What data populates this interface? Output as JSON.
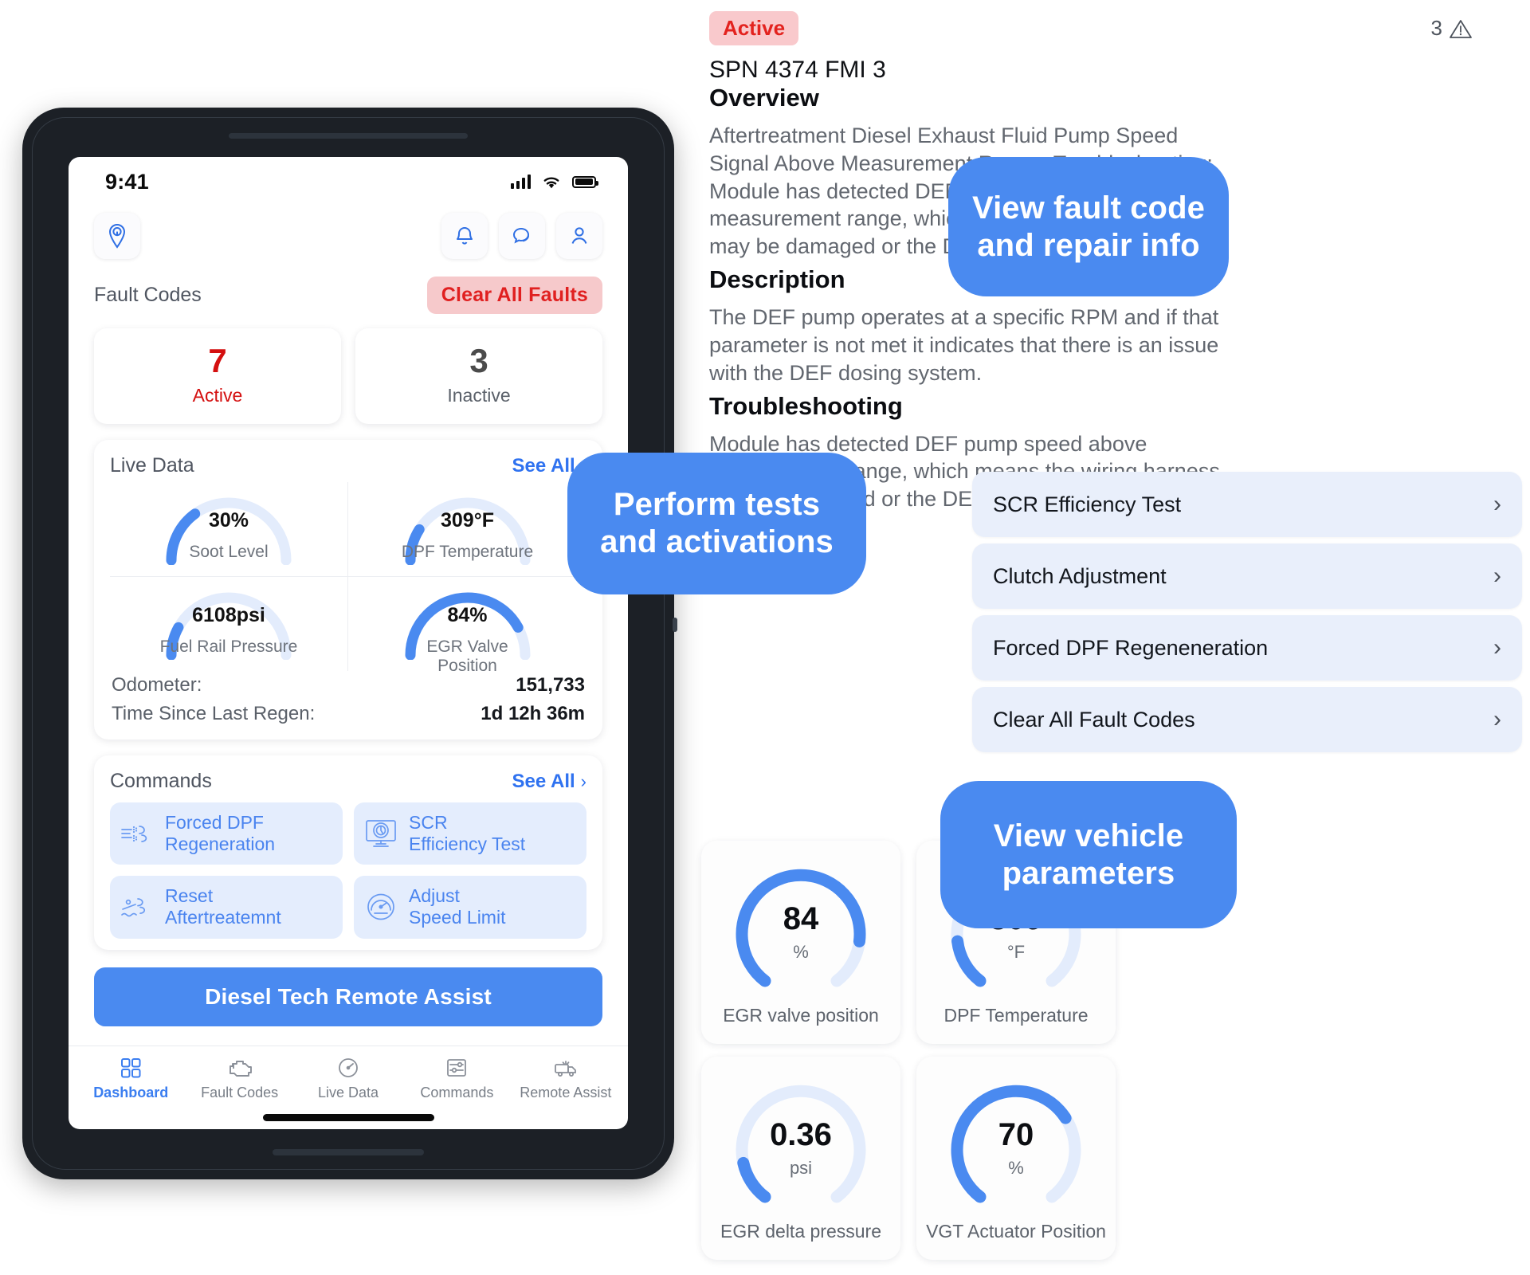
{
  "tablet": {
    "status_bar": {
      "time": "9:41"
    },
    "app_header": {
      "logo_icon": "wrench-location-pin-icon",
      "actions": [
        {
          "icon": "bell-icon",
          "name": "notifications"
        },
        {
          "icon": "chat-bubbles-icon",
          "name": "messages"
        },
        {
          "icon": "user-icon",
          "name": "profile"
        }
      ]
    },
    "fault_codes": {
      "title": "Fault Codes",
      "clear_button": "Clear All Faults",
      "cards": [
        {
          "count": "7",
          "label": "Active"
        },
        {
          "count": "3",
          "label": "Inactive"
        }
      ]
    },
    "live_data": {
      "title": "Live Data",
      "see_all": "See All",
      "chevron": "›",
      "gauges": [
        {
          "value": "30%",
          "label": "Soot Level",
          "pct": 30
        },
        {
          "value": "309°F",
          "label": "DPF Temperature",
          "pct": 18
        },
        {
          "value": "6108psi",
          "label": "Fuel Rail Pressure",
          "pct": 16
        },
        {
          "value": "84%",
          "label": "EGR Valve Position",
          "pct": 84
        }
      ],
      "rows": [
        {
          "key": "Odometer:",
          "value": "151,733"
        },
        {
          "key": "Time Since Last Regen:",
          "value": "1d 12h 36m"
        }
      ]
    },
    "commands": {
      "title": "Commands",
      "see_all": "See All",
      "chevron": "›",
      "items": [
        {
          "label": "Forced DPF\nRegeneration",
          "icon": "dpf-exhaust-icon"
        },
        {
          "label": "SCR\nEfficiency Test",
          "icon": "monitor-gauge-icon"
        },
        {
          "label": "Reset\nAftertreatemnt",
          "icon": "aftertreatment-icon"
        },
        {
          "label": "Adjust\nSpeed Limit",
          "icon": "speedometer-icon"
        }
      ]
    },
    "primary_button": "Diesel Tech Remote Assist",
    "tabbar": [
      {
        "label": "Dashboard",
        "icon": "grid-icon",
        "active": true
      },
      {
        "label": "Fault Codes",
        "icon": "engine-icon",
        "active": false
      },
      {
        "label": "Live Data",
        "icon": "gauge-icon",
        "active": false
      },
      {
        "label": "Commands",
        "icon": "sliders-icon",
        "active": false
      },
      {
        "label": "Remote Assist",
        "icon": "truck-icon",
        "active": false
      }
    ]
  },
  "detail": {
    "status_badge": "Active",
    "warning_count": "3",
    "warning_icon": "warning-triangle-icon",
    "code_title": "SPN 4374 FMI 3",
    "overview_heading": "Overview",
    "overview_body": "Aftertreatment Diesel Exhaust Fluid Pump Speed\nSignal Above Measurement Range. Troubleshooting:\nModule has detected DEF pump speed above\nmeasurement range, which means the wiring harness\nmay be damaged or the DEF pump has failed.",
    "description_heading": "Description",
    "description_body": "The DEF pump operates at a specific RPM and if that\nparameter is not met it indicates that there is an issue\nwith the DEF dosing system.",
    "troubleshooting_heading": "Troubleshooting",
    "troubleshooting_body": "Module has detected DEF pump speed above\nmeasurement range, which means the wiring harness\nmay be damaged or the DEF pump has failed."
  },
  "tests": {
    "chevron": "›",
    "items": [
      {
        "label": "SCR Efficiency Test"
      },
      {
        "label": "Clutch Adjustment"
      },
      {
        "label": "Forced DPF Regeneneration"
      },
      {
        "label": "Clear All Fault Codes"
      }
    ]
  },
  "parameter_gauges": [
    {
      "value": "84",
      "unit": "%",
      "label": "EGR valve position",
      "pct": 84
    },
    {
      "value": "309",
      "unit": "°F",
      "label": "DPF Temperature",
      "pct": 16
    },
    {
      "value": "0.36",
      "unit": "psi",
      "label": "EGR delta pressure",
      "pct": 14
    },
    {
      "value": "70",
      "unit": "%",
      "label": "VGT Actuator Position",
      "pct": 70
    }
  ],
  "callouts": [
    {
      "text": "View fault code\nand repair info"
    },
    {
      "text": "Perform tests\nand activations"
    },
    {
      "text": "View vehicle\nparameters"
    }
  ],
  "colors": {
    "accent_blue": "#4a8af0",
    "alert_red": "#e02020",
    "badge_bg": "#f9c9cc",
    "gauge_track": "#dfe9fb",
    "panel_bg": "#e9effb"
  }
}
